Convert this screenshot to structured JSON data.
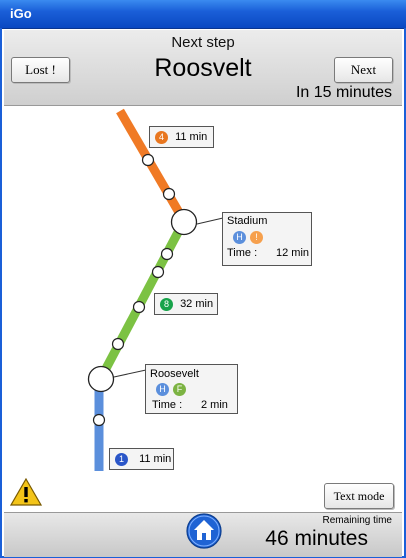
{
  "window": {
    "title": "iGo"
  },
  "header": {
    "next_label": "Next step",
    "station": "Roosvelt",
    "eta": "In 15 minutes",
    "lost_button": "Lost !",
    "next_button": "Next"
  },
  "map": {
    "segments": [
      {
        "badge": "4",
        "badge_color": "#e8761f",
        "time": "11 min",
        "line_color": "#f07a25"
      },
      {
        "badge": "8",
        "badge_color": "#17a34a",
        "time": "32 min",
        "line_color": "#7cc243"
      },
      {
        "badge": "1",
        "badge_color": "#2a56c8",
        "time": "11 min",
        "line_color": "#5b8fdc"
      }
    ],
    "stations": [
      {
        "name": "Stadium",
        "icon1": "H",
        "icon1_color": "#5b8fdc",
        "icon2": "!",
        "icon2_color": "#f6a04d",
        "time_label": "Time :",
        "time": "12 min"
      },
      {
        "name": "Roosevelt",
        "icon1": "H",
        "icon1_color": "#5b8fdc",
        "icon2": "F",
        "icon2_color": "#7cb342",
        "time_label": "Time :",
        "time": "2 min"
      }
    ]
  },
  "footer": {
    "remaining_label": "Remaining time",
    "remaining_value": "46 minutes",
    "text_mode_button": "Text mode"
  }
}
